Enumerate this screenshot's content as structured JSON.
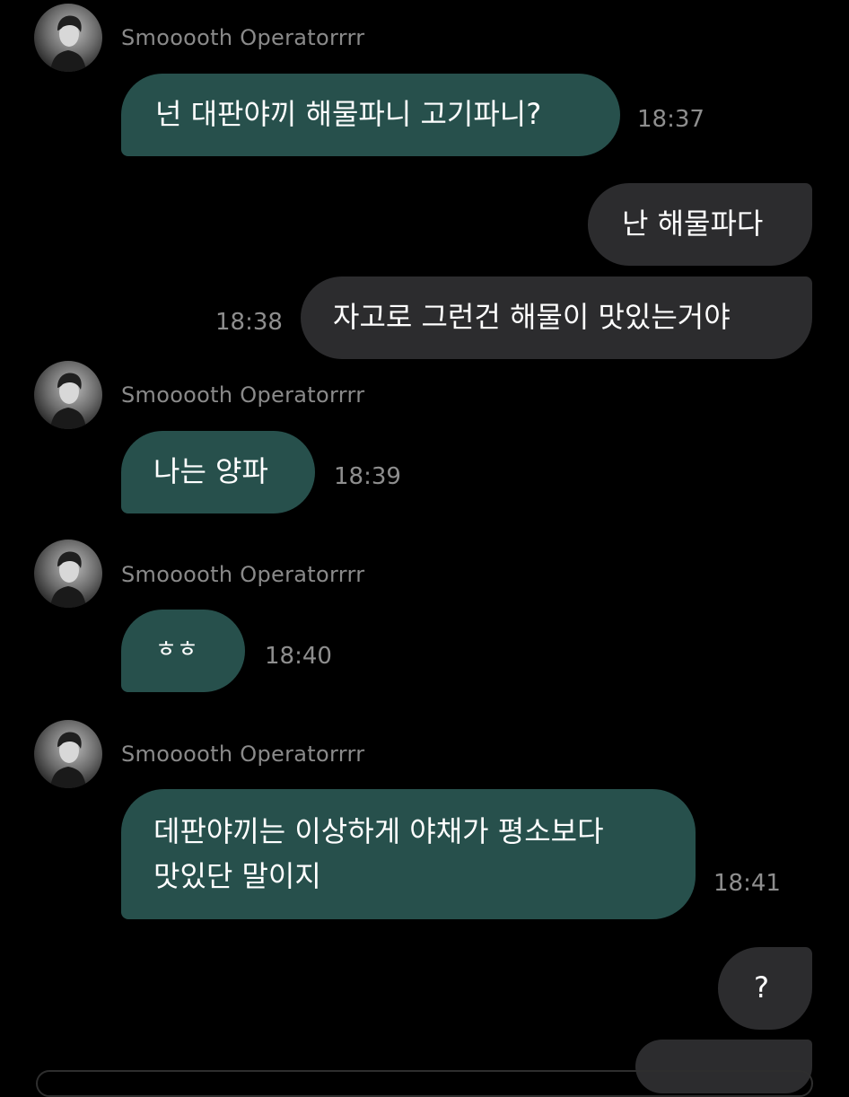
{
  "chat": {
    "sender_name": "Smooooth Operatorrrr",
    "messages": [
      {
        "direction": "in",
        "text": "넌 대판야끼 해물파니 고기파니?",
        "time": "18:37"
      },
      {
        "direction": "out",
        "text": "난 해물파다",
        "time": ""
      },
      {
        "direction": "out",
        "text": "자고로 그런건 해물이 맛있는거야",
        "time": "18:38"
      },
      {
        "direction": "in",
        "text": "나는 양파",
        "time": "18:39"
      },
      {
        "direction": "in",
        "text": "ㅎㅎ",
        "time": "18:40"
      },
      {
        "direction": "in",
        "text_line1": "데판야끼는 이상하게 야채가 평소보다",
        "text_line2": "맛있단 말이지",
        "time": "18:41"
      },
      {
        "direction": "out",
        "text": "?",
        "time": ""
      }
    ]
  },
  "colors": {
    "background": "#000000",
    "incoming_bubble": "#27504c",
    "outgoing_bubble": "#2c2c2e",
    "timestamp": "#8e8e8e",
    "sender_name": "#8a8a8a"
  },
  "icons": {
    "avatar": "profile-photo"
  }
}
